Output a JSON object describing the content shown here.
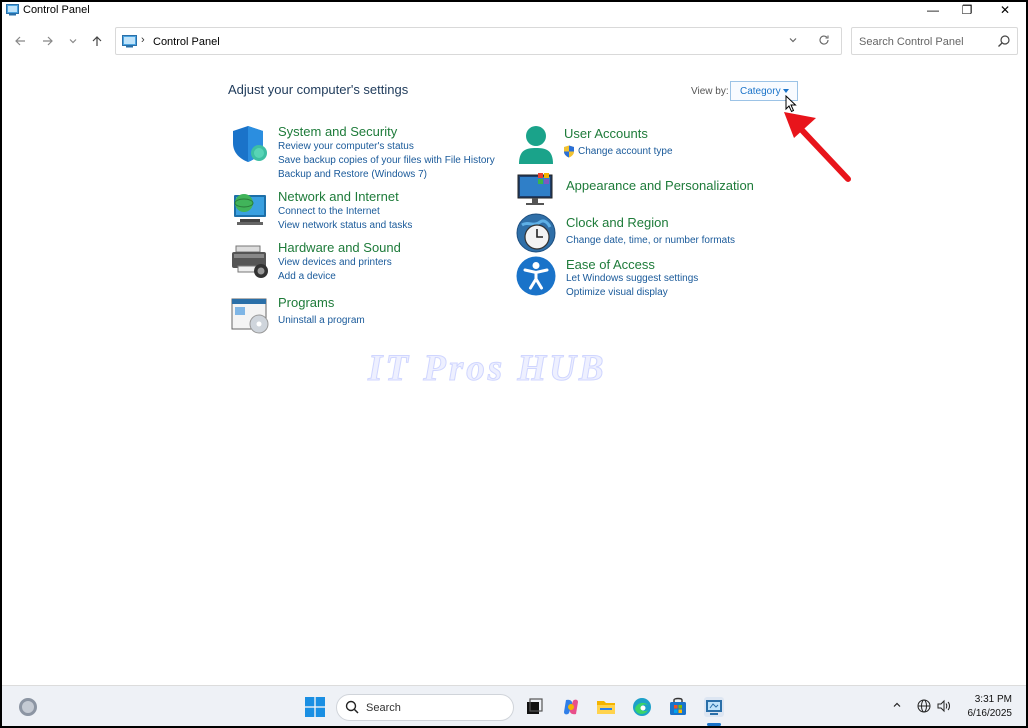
{
  "window": {
    "title": "Control Panel",
    "minimize_glyph": "—",
    "maximize_glyph": "❐",
    "close_glyph": "✕"
  },
  "nav": {
    "back_icon": "arrow-left-icon",
    "forward_icon": "arrow-right-icon",
    "recent_icon": "chevron-down-icon",
    "up_icon": "arrow-up-icon"
  },
  "address": {
    "crumb": "Control Panel",
    "separator": "›"
  },
  "search": {
    "placeholder": "Search Control Panel"
  },
  "main": {
    "heading": "Adjust your computer's settings",
    "view_by_label": "View by:",
    "view_by_value": "Category"
  },
  "categories": {
    "system_security": {
      "name": "System and Security",
      "links": [
        "Review your computer's status",
        "Save backup copies of your files with File History",
        "Backup and Restore (Windows 7)"
      ]
    },
    "network_internet": {
      "name": "Network and Internet",
      "links": [
        "Connect to the Internet",
        "View network status and tasks"
      ]
    },
    "hardware_sound": {
      "name": "Hardware and Sound",
      "links": [
        "View devices and printers",
        "Add a device"
      ]
    },
    "programs": {
      "name": "Programs",
      "links": [
        "Uninstall a program"
      ]
    },
    "user_accounts": {
      "name": "User Accounts",
      "links": [
        "Change account type"
      ]
    },
    "appearance": {
      "name": "Appearance and Personalization",
      "links": []
    },
    "clock_region": {
      "name": "Clock and Region",
      "links": [
        "Change date, time, or number formats"
      ]
    },
    "ease_access": {
      "name": "Ease of Access",
      "links": [
        "Let Windows suggest settings",
        "Optimize visual display"
      ]
    }
  },
  "watermark": "IT Pros HUB",
  "taskbar": {
    "search_label": "Search",
    "time": "3:31 PM",
    "date": "6/16/2025",
    "apps": [
      "task-view-icon",
      "copilot-icon",
      "file-explorer-icon",
      "edge-icon",
      "store-icon",
      "control-panel-icon"
    ]
  },
  "colors": {
    "category_name": "#1e7b3a",
    "link": "#1a5a9a",
    "accent": "#1a73c9",
    "annotation_arrow": "#e8141b"
  }
}
